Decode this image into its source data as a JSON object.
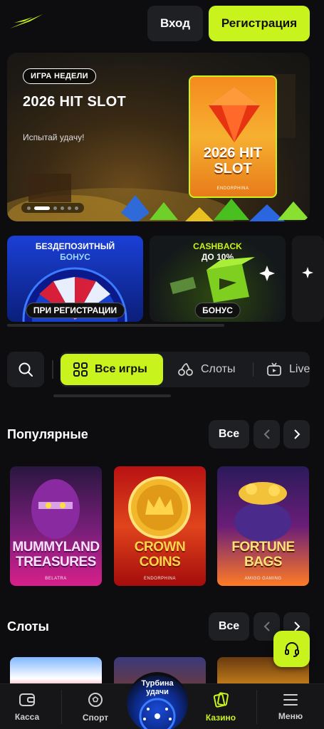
{
  "header": {
    "login_label": "Вход",
    "register_label": "Регистрация",
    "accent_color": "#c8f31d"
  },
  "hero": {
    "badge": "ИГРА НЕДЕЛИ",
    "title": "2026 HIT SLOT",
    "subtitle": "Испытай удачу!",
    "card_title": "2026 HIT SLOT",
    "card_provider": "ENDORPHINA",
    "slides_total": 6,
    "active_slide": 1
  },
  "promos": [
    {
      "line1": "БЕЗДЕПОЗИТНЫЙ",
      "line2": "БОНУС",
      "button": "ПРИ РЕГИСТРАЦИИ"
    },
    {
      "line1": "CASHBACK",
      "line2": "ДО 10%",
      "button": "БОНУС"
    }
  ],
  "filter": {
    "tabs": [
      {
        "label": "Все игры",
        "icon": "grid-icon",
        "active": true
      },
      {
        "label": "Слоты",
        "icon": "cherries-icon",
        "active": false
      },
      {
        "label": "Live",
        "icon": "tv-icon",
        "active": false
      }
    ]
  },
  "sections": {
    "popular": {
      "title": "Популярные",
      "all_label": "Все",
      "games": [
        {
          "title_line1": "MUMMYLAND",
          "title_line2": "TREASURES",
          "provider": "BELATRA"
        },
        {
          "title_line1": "CROWN",
          "title_line2": "COINS",
          "provider": "ENDORPHINA"
        },
        {
          "title_line1": "FORTUNE",
          "title_line2": "BAGS",
          "provider": "AMIGO GAMING"
        }
      ]
    },
    "slots": {
      "title": "Слоты",
      "all_label": "Все"
    }
  },
  "bottom_nav": {
    "items": [
      {
        "label": "Касса",
        "icon": "wallet-icon"
      },
      {
        "label": "Спорт",
        "icon": "ball-icon"
      },
      {
        "label": "Казино",
        "icon": "casino-icon",
        "active": true
      },
      {
        "label": "Меню",
        "icon": "menu-icon"
      }
    ],
    "wheel_line1": "Турбина",
    "wheel_line2": "удачи"
  }
}
